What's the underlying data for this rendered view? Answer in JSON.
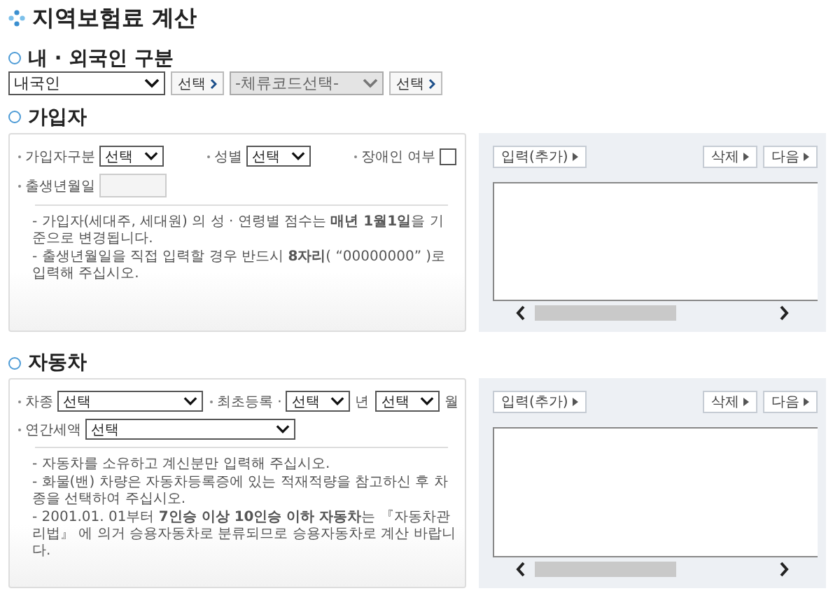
{
  "title": "지역보험료 계산",
  "nationality": {
    "heading": "내 · 외국인 구분",
    "controls": [
      {
        "value": "내국인",
        "disabled": false,
        "button": "선택"
      },
      {
        "value": "-체류코드선택-",
        "disabled": true,
        "button": "선택"
      }
    ]
  },
  "subscriber": {
    "heading": "가입자",
    "rows": [
      [
        {
          "kind": "select",
          "label": "가입자구분",
          "value": "선택"
        },
        {
          "kind": "select",
          "label": "성별",
          "value": "선택"
        },
        {
          "kind": "checkbox",
          "label": "장애인 여부",
          "checked": false
        }
      ],
      [
        {
          "kind": "text",
          "label": "출생년월일"
        }
      ]
    ],
    "notes": [
      "- 가입자(세대주, 세대원) 의 성 · 연령별 점수는 **매년 1월1일**을 기준으로 변경됩니다.",
      "- 출생년월일을 직접 입력할 경우 반드시 **8자리**( “00000000” )로 입력해 주십시오."
    ],
    "side": {
      "add": "입력(추가)",
      "delete": "삭제",
      "next": "다음"
    }
  },
  "vehicle": {
    "heading": "자동차",
    "rows": [
      [
        {
          "kind": "select",
          "label": "차종",
          "value": "선택"
        },
        {
          "kind": "select",
          "label": "최초등록 ·",
          "value": "선택",
          "unit": "년"
        },
        {
          "kind": "select",
          "value": "선택",
          "unit": "월"
        }
      ],
      [
        {
          "kind": "select",
          "label": "연간세액",
          "value": "선택"
        }
      ]
    ],
    "notes": [
      "- 자동차를 소유하고 계신분만 입력해 주십시오.",
      "- 화물(밴) 차량은 자동차등록증에 있는 적재적량을 참고하신 후 차종을 선택하여 주십시오.",
      "- 2001.01. 01부터 **7인승 이상 10인승 이하 자동차**는 『자동차관리법』 에 의거 승용자동차로 분류되므로 승용자동차로 계산 바랍니다."
    ],
    "side": {
      "add": "입력(추가)",
      "delete": "삭제",
      "next": "다음"
    }
  }
}
